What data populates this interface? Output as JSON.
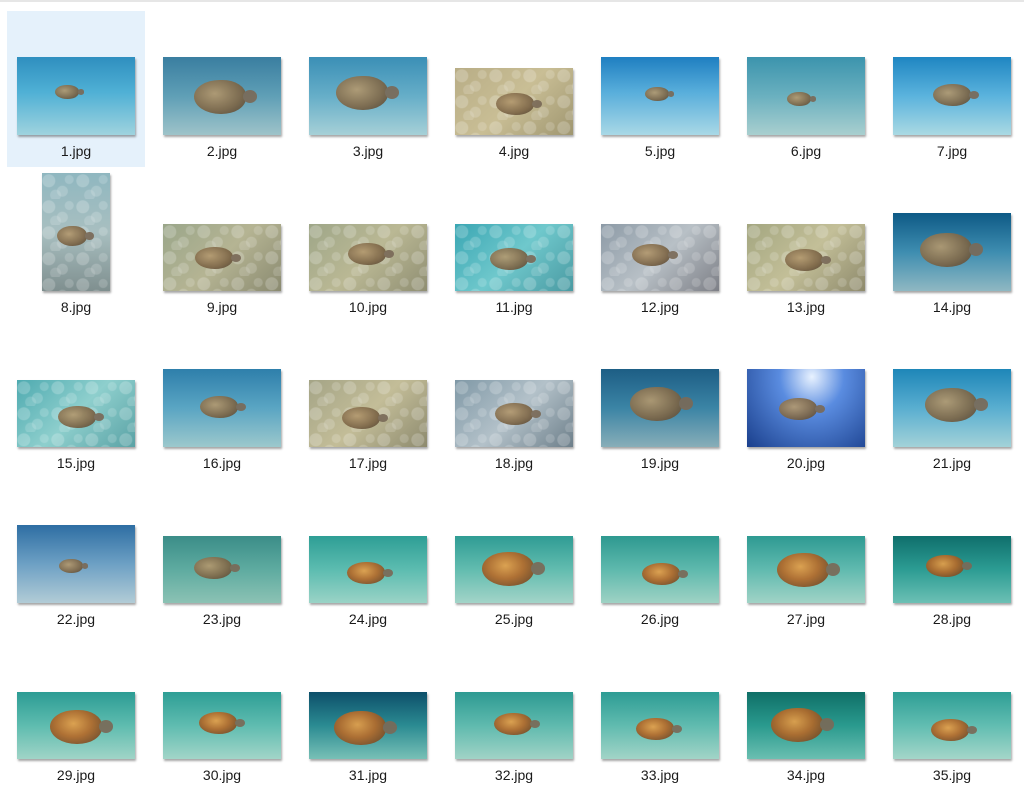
{
  "files": [
    {
      "name": "1.jpg",
      "selected": true,
      "shape": "wide",
      "bg": "linear-gradient(180deg,#2f8fbf 0%,#4fb0d5 45%,#9fd3de 100%)",
      "turtle": "small",
      "style": "green"
    },
    {
      "name": "2.jpg",
      "shape": "wide",
      "bg": "linear-gradient(180deg,#3a7ea0 0%,#5f9fb6 50%,#9ec3c9 100%)",
      "turtle": "big",
      "style": "green"
    },
    {
      "name": "3.jpg",
      "shape": "wide",
      "bg": "linear-gradient(180deg,#3b8fb6 0%,#66aec8 50%,#a6d0d7 100%)",
      "turtle": "big",
      "style": "green"
    },
    {
      "name": "4.jpg",
      "shape": "short",
      "bg": "linear-gradient(135deg,#b8ad86 0%,#c9be95 50%,#9f9670 100%)",
      "turtle": "mid",
      "style": "green",
      "caustics": true
    },
    {
      "name": "5.jpg",
      "shape": "wide",
      "bg": "linear-gradient(180deg,#1f7fc1 0%,#58aedb 45%,#a9d8e6 100%)",
      "turtle": "small",
      "style": "green"
    },
    {
      "name": "6.jpg",
      "shape": "wide",
      "bg": "linear-gradient(180deg,#3c94ad 0%,#6ab0bf 50%,#a9cfcf 100%)",
      "turtle": "small",
      "style": "green"
    },
    {
      "name": "7.jpg",
      "shape": "wide",
      "bg": "linear-gradient(180deg,#1f86c2 0%,#5bb3dd 50%,#aad9e3 100%)",
      "turtle": "mid",
      "style": "green"
    },
    {
      "name": "8.jpg",
      "shape": "tall",
      "bg": "linear-gradient(180deg,#8fb7c0 0%,#a8bfc0 50%,#7f8f8f 100%)",
      "turtle": "mid",
      "style": "green",
      "caustics": true
    },
    {
      "name": "9.jpg",
      "shape": "short",
      "bg": "linear-gradient(135deg,#9aa68a 0%,#b5b493 50%,#8a8a70 100%)",
      "turtle": "mid",
      "style": "green",
      "caustics": true
    },
    {
      "name": "10.jpg",
      "shape": "short",
      "bg": "linear-gradient(135deg,#9ea688 0%,#bab894 50%,#8f8e72 100%)",
      "turtle": "mid",
      "style": "green",
      "caustics": true
    },
    {
      "name": "11.jpg",
      "shape": "short",
      "bg": "linear-gradient(135deg,#3aa6b3 0%,#6fc8cc 50%,#4a9aa2 100%)",
      "turtle": "mid",
      "style": "green",
      "caustics": true
    },
    {
      "name": "12.jpg",
      "shape": "short",
      "bg": "linear-gradient(135deg,#8c9aa6 0%,#b8c0c6 50%,#7d7f86 100%)",
      "turtle": "mid",
      "style": "green",
      "caustics": true
    },
    {
      "name": "13.jpg",
      "shape": "short",
      "bg": "linear-gradient(135deg,#a3a680 0%,#c3bf98 50%,#8e8a6c 100%)",
      "turtle": "mid",
      "style": "green",
      "caustics": true
    },
    {
      "name": "14.jpg",
      "shape": "wide",
      "bg": "linear-gradient(180deg,#0e5a86 0%,#3e8db0 50%,#8fb8c2 100%)",
      "turtle": "big",
      "style": "green"
    },
    {
      "name": "15.jpg",
      "shape": "short",
      "bg": "linear-gradient(135deg,#4eaab0 0%,#8ecfcd 50%,#5aa2a5 100%)",
      "turtle": "mid",
      "style": "green",
      "caustics": true
    },
    {
      "name": "16.jpg",
      "shape": "wide",
      "bg": "linear-gradient(180deg,#2e7fab 0%,#5aa5c3 50%,#9cc8cc 100%)",
      "turtle": "mid",
      "style": "green"
    },
    {
      "name": "17.jpg",
      "shape": "short",
      "bg": "linear-gradient(135deg,#a4a486 0%,#c3bd98 50%,#8d8a6e 100%)",
      "turtle": "mid",
      "style": "green",
      "caustics": true
    },
    {
      "name": "18.jpg",
      "shape": "short",
      "bg": "linear-gradient(135deg,#7f98a6 0%,#b3c1c9 50%,#6d7f8a 100%)",
      "turtle": "mid",
      "style": "green",
      "caustics": true
    },
    {
      "name": "19.jpg",
      "shape": "wide",
      "bg": "linear-gradient(180deg,#1d5e85 0%,#3b84a5 50%,#88aeb8 100%)",
      "turtle": "big",
      "style": "green"
    },
    {
      "name": "20.jpg",
      "shape": "wide",
      "bg": "radial-gradient(ellipse at 55% 10%,#e8f2ff 0%,#5a8ce0 35%,#1a3f8c 100%)",
      "turtle": "mid",
      "style": "green"
    },
    {
      "name": "21.jpg",
      "shape": "wide",
      "bg": "linear-gradient(180deg,#1e86b8 0%,#59aed0 50%,#a3d2d8 100%)",
      "turtle": "big",
      "style": "green"
    },
    {
      "name": "22.jpg",
      "shape": "wide",
      "bg": "linear-gradient(180deg,#2e6ea3 0%,#6da0c4 50%,#b2ccd6 100%)",
      "turtle": "small",
      "style": "green"
    },
    {
      "name": "23.jpg",
      "shape": "short",
      "bg": "linear-gradient(180deg,#3b8d88 0%,#5eaba0 50%,#8cc2b4 100%)",
      "turtle": "mid",
      "style": "green"
    },
    {
      "name": "24.jpg",
      "shape": "short",
      "bg": "linear-gradient(180deg,#2e9e95 0%,#5cbcb0 50%,#9ad3c6 100%)",
      "turtle": "mid",
      "style": "loggerhead"
    },
    {
      "name": "25.jpg",
      "shape": "short",
      "bg": "linear-gradient(180deg,#2f9c94 0%,#62bcaf 50%,#a3d4c8 100%)",
      "turtle": "big",
      "style": "loggerhead"
    },
    {
      "name": "26.jpg",
      "shape": "short",
      "bg": "linear-gradient(180deg,#2e9990 0%,#5eb9ad 50%,#9fd2c4 100%)",
      "turtle": "mid",
      "style": "loggerhead"
    },
    {
      "name": "27.jpg",
      "shape": "short",
      "bg": "linear-gradient(180deg,#2e9a92 0%,#60baaf 50%,#a1d3c6 100%)",
      "turtle": "big",
      "style": "loggerhead"
    },
    {
      "name": "28.jpg",
      "shape": "short",
      "bg": "linear-gradient(180deg,#0f6f6c 0%,#2c9c93 50%,#6cc0b4 100%)",
      "turtle": "mid",
      "style": "loggerhead"
    },
    {
      "name": "29.jpg",
      "shape": "short",
      "bg": "linear-gradient(180deg,#2c9c94 0%,#5ebcaf 50%,#a0d4c7 100%)",
      "turtle": "big",
      "style": "loggerhead"
    },
    {
      "name": "30.jpg",
      "shape": "short",
      "bg": "linear-gradient(180deg,#2e9e95 0%,#5fbcb0 50%,#a2d5c8 100%)",
      "turtle": "mid",
      "style": "loggerhead"
    },
    {
      "name": "31.jpg",
      "shape": "short",
      "bg": "linear-gradient(180deg,#0d4f6a 0%,#2b8b92 50%,#78c0b6 100%)",
      "turtle": "big",
      "style": "loggerhead"
    },
    {
      "name": "32.jpg",
      "shape": "short",
      "bg": "linear-gradient(180deg,#2d9a92 0%,#5fbaae 50%,#a1d3c6 100%)",
      "turtle": "mid",
      "style": "loggerhead"
    },
    {
      "name": "33.jpg",
      "shape": "short",
      "bg": "linear-gradient(180deg,#2d9c94 0%,#60bbaf 50%,#a2d4c7 100%)",
      "turtle": "mid",
      "style": "loggerhead"
    },
    {
      "name": "34.jpg",
      "shape": "short",
      "bg": "linear-gradient(180deg,#0f6f67 0%,#2a9a8e 50%,#6bbfb1 100%)",
      "turtle": "big",
      "style": "loggerhead"
    },
    {
      "name": "35.jpg",
      "shape": "short",
      "bg": "linear-gradient(180deg,#2e9e95 0%,#61bdb1 50%,#a4d6c9 100%)",
      "turtle": "mid",
      "style": "loggerhead"
    }
  ]
}
